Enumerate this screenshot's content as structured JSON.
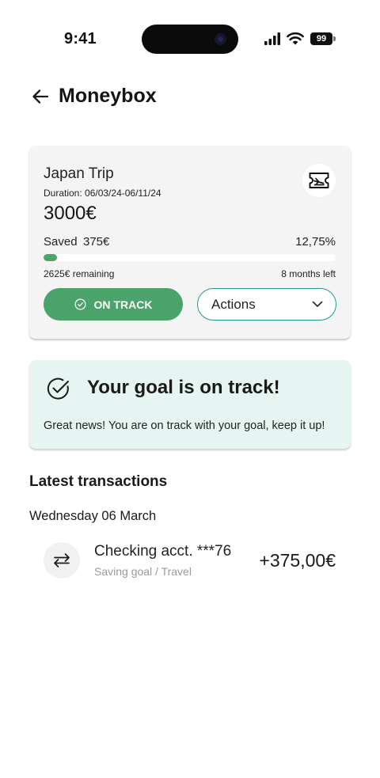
{
  "status_bar": {
    "time": "9:41",
    "battery_level": "99",
    "icons": [
      "cellular-signal-icon",
      "wifi-icon",
      "battery-icon"
    ]
  },
  "header": {
    "title": "Moneybox",
    "back_icon": "arrow-left-icon"
  },
  "goal": {
    "name": "Japan Trip",
    "duration": "Duration: 06/03/24-06/11/24",
    "target_amount": "3000€",
    "saved_label": "Saved",
    "saved_amount": "375€",
    "percent_text": "12,75%",
    "progress_fraction": 0.045,
    "remaining": "2625€ remaining",
    "months_left": "8 months left",
    "category_icon": "airplane-ticket-icon",
    "status_button": "ON TRACK",
    "actions_label": "Actions"
  },
  "banner": {
    "title": "Your goal is on track!",
    "text": "Great news! You are on track with your goal, keep it up!",
    "icon": "check-circle-icon"
  },
  "transactions": {
    "section_title": "Latest transactions",
    "groups": [
      {
        "date": "Wednesday 06 March",
        "items": [
          {
            "title": "Checking acct. ***76",
            "subtitle": "Saving goal / Travel",
            "amount": "+375,00€",
            "icon": "transfer-arrows-icon"
          }
        ]
      }
    ]
  },
  "colors": {
    "accent_green": "#4aa36a",
    "teal_border": "#1f9b8c",
    "banner_bg": "#e6f5f2",
    "card_bg": "#f4f4f4"
  }
}
